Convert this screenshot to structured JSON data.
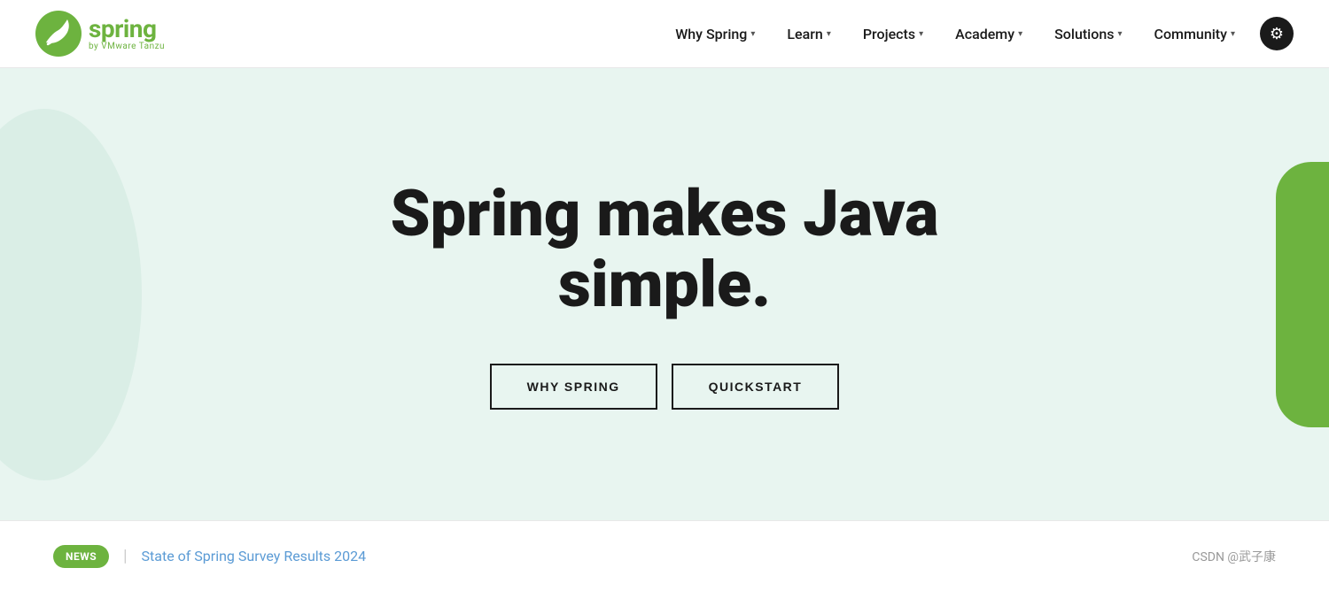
{
  "header": {
    "logo": {
      "spring_text": "spring",
      "byline": "by VMware Tanzu"
    },
    "nav": [
      {
        "label": "Why Spring",
        "id": "why-spring"
      },
      {
        "label": "Learn",
        "id": "learn"
      },
      {
        "label": "Projects",
        "id": "projects"
      },
      {
        "label": "Academy",
        "id": "academy"
      },
      {
        "label": "Solutions",
        "id": "solutions"
      },
      {
        "label": "Community",
        "id": "community"
      }
    ],
    "settings_icon": "⚙"
  },
  "hero": {
    "title_line1": "Spring makes Java",
    "title_line2": "simple.",
    "button_why_spring": "WHY SPRING",
    "button_quickstart": "QUICKSTART"
  },
  "news_bar": {
    "badge": "NEWS",
    "divider": "|",
    "link_text": "State of Spring Survey Results 2024",
    "watermark": "CSDN @武子康"
  }
}
